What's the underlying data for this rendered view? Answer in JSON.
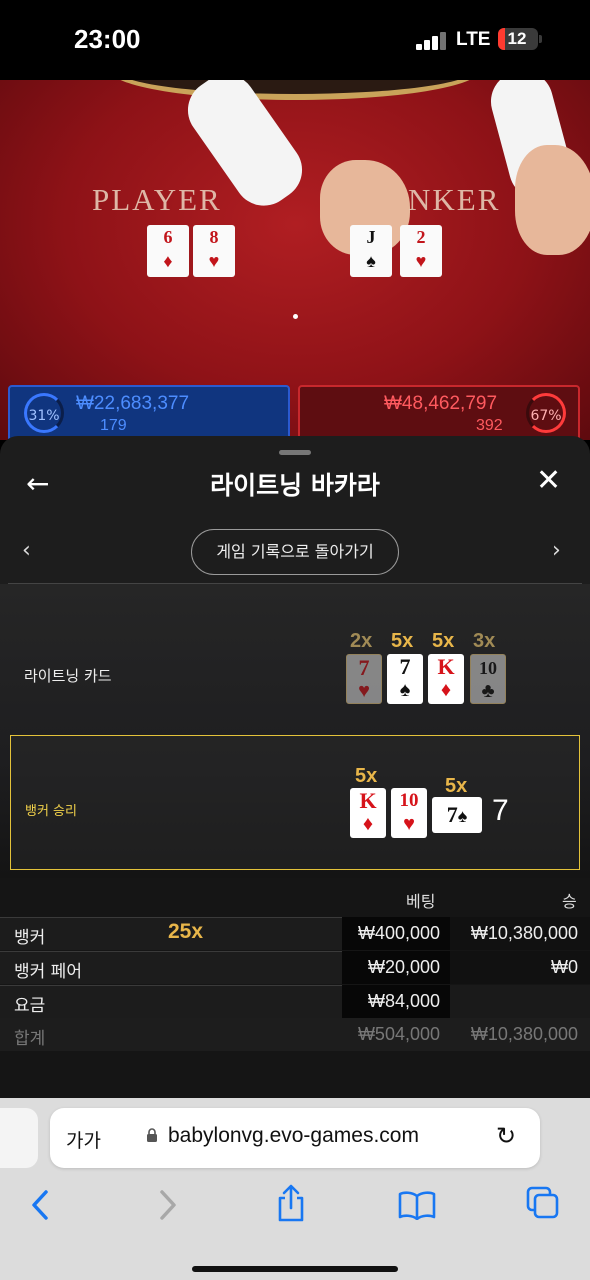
{
  "status_bar": {
    "time": "23:00",
    "network": "LTE",
    "battery": "12"
  },
  "video": {
    "player_label": "PLAYER",
    "banker_label": "NKER",
    "player_cards": [
      {
        "rank": "6",
        "suit": "♦"
      },
      {
        "rank": "8",
        "suit": "♥"
      }
    ],
    "banker_cards": [
      {
        "rank": "J",
        "suit": "♠"
      },
      {
        "rank": "2",
        "suit": "♥"
      }
    ],
    "player_pct": "31%",
    "player_amount": "₩22,683,377",
    "player_count": "179",
    "banker_pct": "67%",
    "banker_amount": "₩48,462,797",
    "banker_count": "392"
  },
  "sheet": {
    "title": "라이트닝 바카라",
    "back_button": "←",
    "close_button": "✕",
    "prev": "‹",
    "next": "›",
    "history_button": "게임 기록으로 돌아가기"
  },
  "lightning": {
    "label": "라이트닝 카드",
    "multipliers": [
      "2x",
      "5x",
      "5x",
      "3x"
    ],
    "cards": [
      {
        "rank": "7",
        "suit": "♥"
      },
      {
        "rank": "7",
        "suit": "♠"
      },
      {
        "rank": "K",
        "suit": "♦"
      },
      {
        "rank": "10",
        "suit": "♣"
      }
    ]
  },
  "result": {
    "label": "뱅커 승리",
    "multipliers": [
      "5x",
      "5x"
    ],
    "cards": [
      {
        "rank": "K",
        "suit": "♦"
      },
      {
        "rank": "10",
        "suit": "♥"
      },
      {
        "rank": "7",
        "suit": "♠"
      }
    ],
    "score": "7"
  },
  "bet_table": {
    "headers": {
      "bet": "베팅",
      "win": "승"
    },
    "rows": [
      {
        "label": "뱅커",
        "multiplier": "25x",
        "bet": "₩400,000",
        "win": "₩10,380,000"
      },
      {
        "label": "뱅커 페어",
        "bet": "₩20,000",
        "win": "₩0"
      },
      {
        "label": "요금",
        "bet": "₩84,000",
        "win": ""
      }
    ],
    "total": {
      "label": "합계",
      "bet": "₩504,000",
      "win": "₩10,380,000"
    }
  },
  "browser": {
    "text_size": "가가",
    "url": "babylonvg.evo-games.com"
  },
  "colors": {
    "accent": "#1877f2",
    "gold": "#e8b64a",
    "highlight_border": "#e3c23a"
  }
}
